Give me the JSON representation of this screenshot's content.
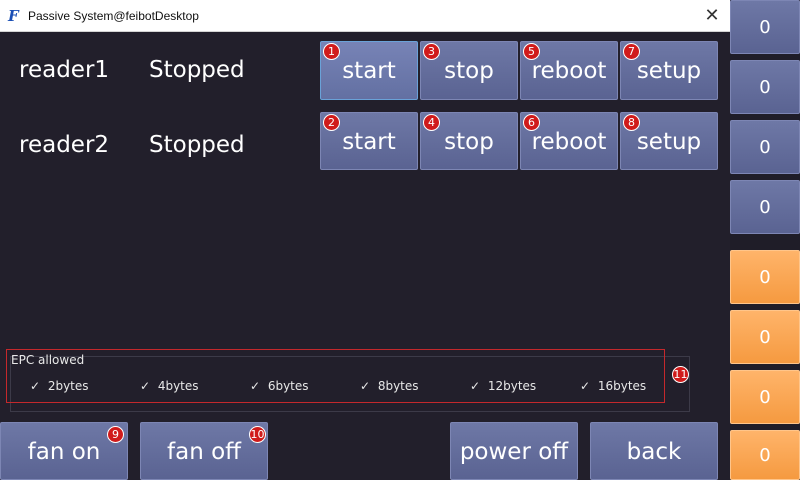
{
  "window": {
    "title": "Passive System@feibotDesktop",
    "app_icon": "F",
    "close_icon": "✕"
  },
  "readers": [
    {
      "name": "reader1",
      "status": "Stopped"
    },
    {
      "name": "reader2",
      "status": "Stopped"
    }
  ],
  "reader_buttons": {
    "row1": [
      {
        "label": "start",
        "badge": "1"
      },
      {
        "label": "stop",
        "badge": "3"
      },
      {
        "label": "reboot",
        "badge": "5"
      },
      {
        "label": "setup",
        "badge": "7"
      }
    ],
    "row2": [
      {
        "label": "start",
        "badge": "2"
      },
      {
        "label": "stop",
        "badge": "4"
      },
      {
        "label": "reboot",
        "badge": "6"
      },
      {
        "label": "setup",
        "badge": "8"
      }
    ]
  },
  "epc": {
    "title": "EPC allowed",
    "badge": "11",
    "check_glyph": "✓",
    "options": [
      "2bytes",
      "4bytes",
      "6bytes",
      "8bytes",
      "12bytes",
      "16bytes"
    ]
  },
  "bottom": {
    "fan_on": {
      "label": "fan on",
      "badge": "9"
    },
    "fan_off": {
      "label": "fan off",
      "badge": "10"
    },
    "power_off": {
      "label": "power off"
    },
    "back": {
      "label": "back"
    }
  },
  "side_counters": [
    {
      "value": "0",
      "color": "blue"
    },
    {
      "value": "0",
      "color": "blue"
    },
    {
      "value": "0",
      "color": "blue"
    },
    {
      "value": "0",
      "color": "blue"
    },
    {
      "value": "0",
      "color": "orange"
    },
    {
      "value": "0",
      "color": "orange"
    },
    {
      "value": "0",
      "color": "orange"
    },
    {
      "value": "0",
      "color": "orange"
    }
  ],
  "colors": {
    "accent_blue": "#636c9b",
    "accent_orange": "#f8a34e",
    "badge_red": "#d01b1b",
    "background": "#221f2b"
  }
}
